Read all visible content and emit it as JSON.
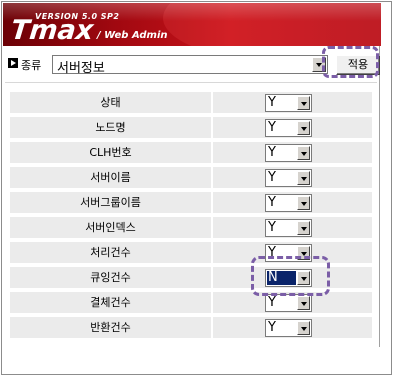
{
  "header": {
    "version": "VERSION 5.0 SP2",
    "logo": "Tmax",
    "subtitle": "/ Web Admin"
  },
  "toolbar": {
    "type_label": "종류",
    "type_value": "서버정보",
    "apply_label": "적용"
  },
  "rows": [
    {
      "label": "상태",
      "value": "Y"
    },
    {
      "label": "노드명",
      "value": "Y"
    },
    {
      "label": "CLH번호",
      "value": "Y"
    },
    {
      "label": "서버이름",
      "value": "Y"
    },
    {
      "label": "서버그룹이름",
      "value": "Y"
    },
    {
      "label": "서버인덱스",
      "value": "Y"
    },
    {
      "label": "처리건수",
      "value": "Y"
    },
    {
      "label": "큐잉건수",
      "value": "N"
    },
    {
      "label": "결체건수",
      "value": "Y"
    },
    {
      "label": "반환건수",
      "value": "Y"
    }
  ],
  "colors": {
    "header_red": "#c8141b",
    "highlight": "#7b5ea7",
    "selected_bg": "#0a246a"
  }
}
